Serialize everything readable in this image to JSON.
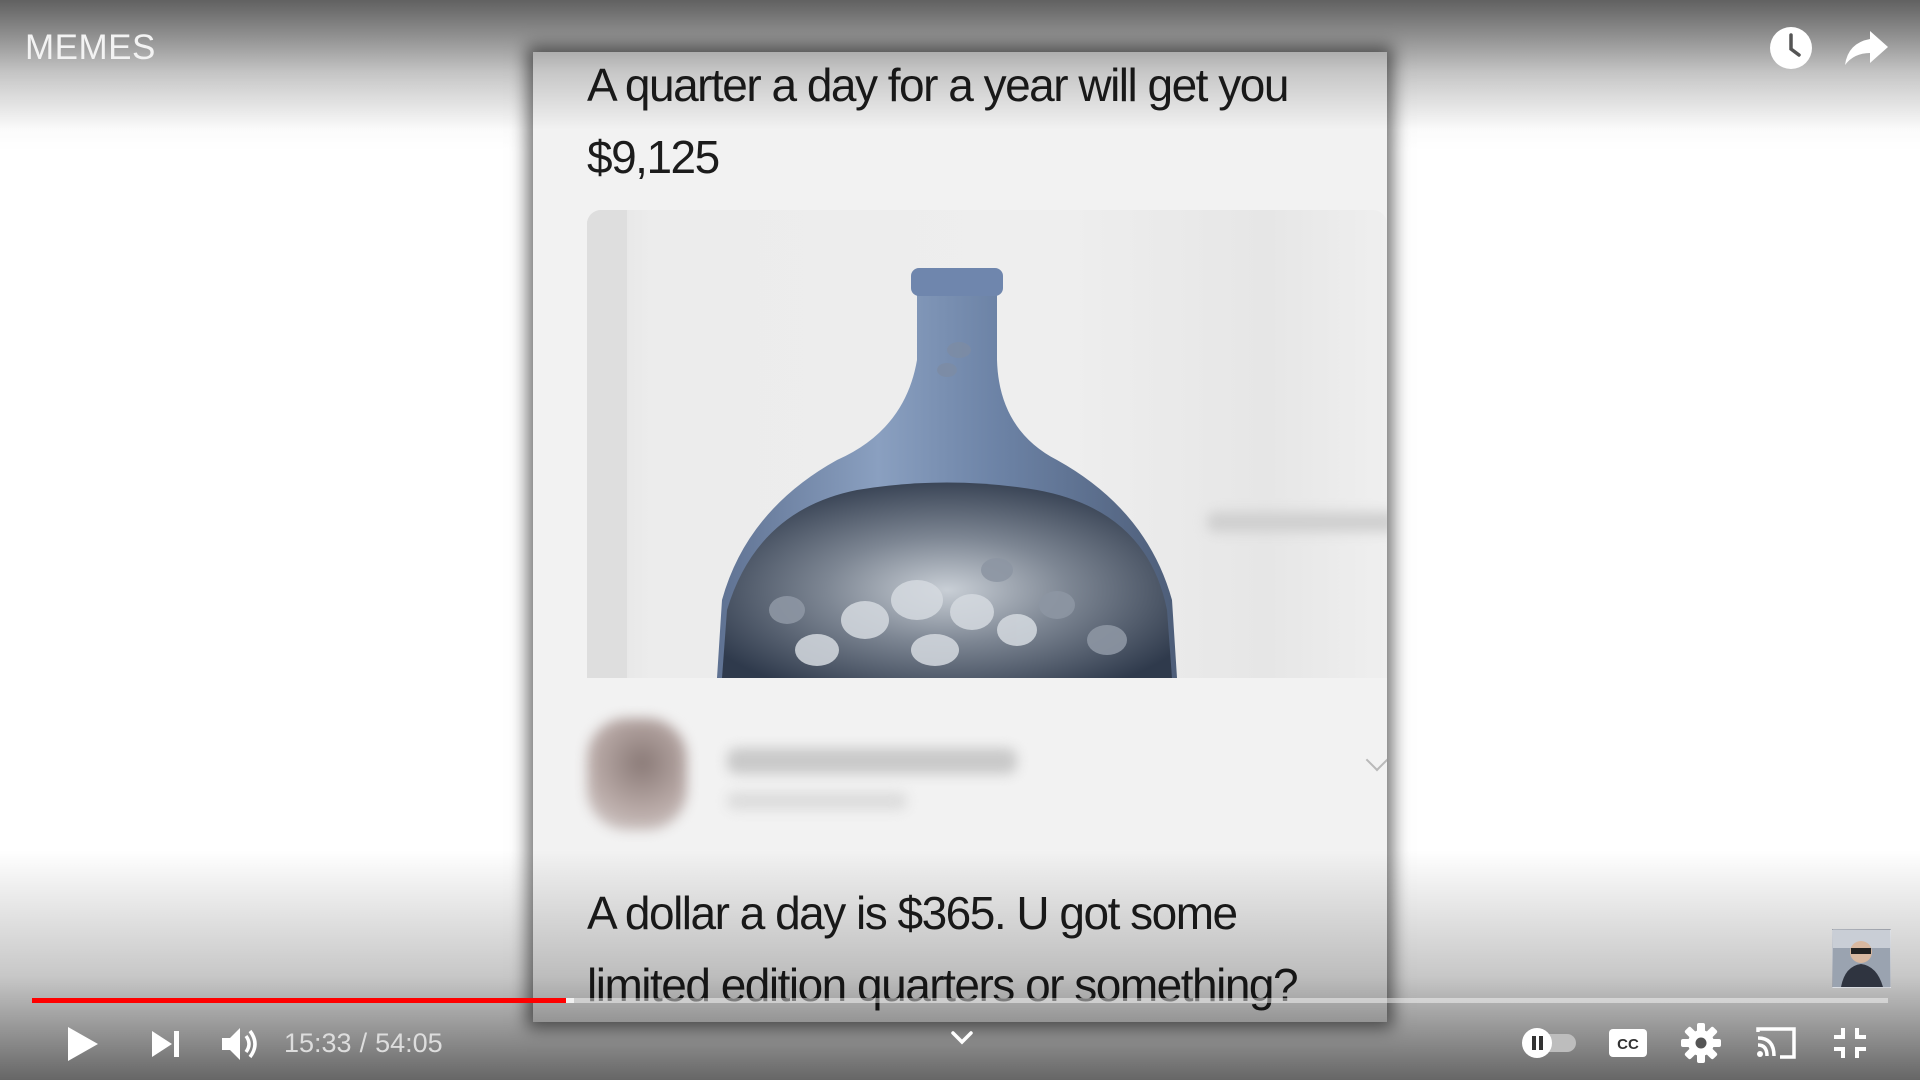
{
  "player": {
    "channel_title": "MEMES",
    "time": {
      "current": "15:33",
      "separator": "/",
      "duration": "54:05"
    },
    "progress": {
      "played_fraction": 0.2877,
      "buffered_fraction": 0.2922
    },
    "colors": {
      "progress_played": "#ff0000",
      "controls": "#ffffff"
    },
    "icons": {
      "watch_later": "clock-icon",
      "share": "share-arrow-icon",
      "play": "play-icon",
      "next": "next-icon",
      "volume": "volume-icon",
      "more": "chevron-down-icon",
      "autoplay": "autoplay-toggle-icon",
      "captions": "cc-icon",
      "settings": "gear-icon",
      "cast": "cast-icon",
      "exit_fullscreen": "exit-fullscreen-icon"
    },
    "autoplay_on": false
  },
  "meme": {
    "top_text_line1": "A quarter a day for a year will get you",
    "top_text_line2": "$9,125",
    "bottom_text_line1": "A dollar a day is $365. U got some",
    "bottom_text_line2": "limited edition quarters or something?"
  }
}
